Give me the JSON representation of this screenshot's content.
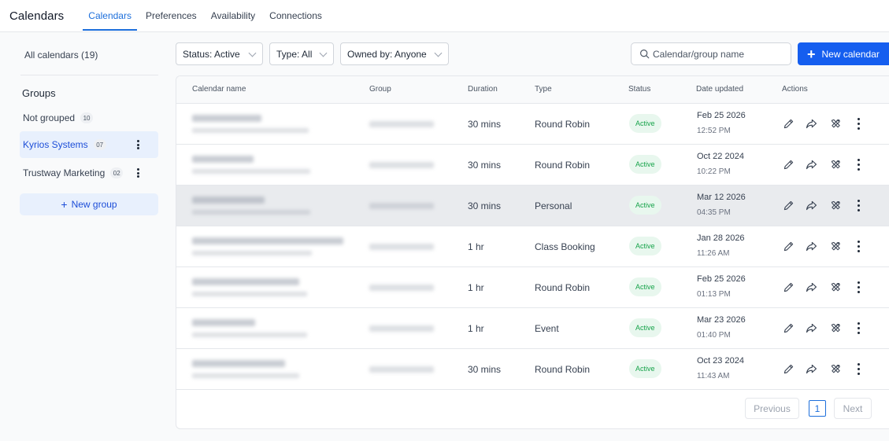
{
  "header": {
    "title": "Calendars",
    "tabs": [
      {
        "label": "Calendars",
        "active": true
      },
      {
        "label": "Preferences",
        "active": false
      },
      {
        "label": "Availability",
        "active": false
      },
      {
        "label": "Connections",
        "active": false
      }
    ]
  },
  "sidebar": {
    "all_calendars": "All calendars (19)",
    "groups_title": "Groups",
    "groups": [
      {
        "label": "Not grouped",
        "count": "10",
        "selected": false
      },
      {
        "label": "Kyrios Systems",
        "count": "07",
        "selected": true
      },
      {
        "label": "Trustway Marketing",
        "count": "02",
        "selected": false
      }
    ],
    "new_group_label": "New group"
  },
  "filters": {
    "status": "Status: Active",
    "type": "Type: All",
    "owned_by": "Owned by: Anyone"
  },
  "search": {
    "placeholder": "Calendar/group name"
  },
  "new_calendar_label": "New calendar",
  "table": {
    "columns": [
      "Calendar name",
      "Group",
      "Duration",
      "Type",
      "Status",
      "Date updated",
      "Actions"
    ],
    "rows": [
      {
        "duration": "30 mins",
        "type": "Round Robin",
        "status": "Active",
        "date": "Feb 25 2026",
        "time": "12:52 PM"
      },
      {
        "duration": "30 mins",
        "type": "Round Robin",
        "status": "Active",
        "date": "Oct 22 2024",
        "time": "10:22 PM"
      },
      {
        "duration": "30 mins",
        "type": "Personal",
        "status": "Active",
        "date": "Mar 12 2026",
        "time": "04:35 PM"
      },
      {
        "duration": "1 hr",
        "type": "Class Booking",
        "status": "Active",
        "date": "Jan 28 2026",
        "time": "11:26 AM"
      },
      {
        "duration": "1 hr",
        "type": "Round Robin",
        "status": "Active",
        "date": "Feb 25 2026",
        "time": "01:13 PM"
      },
      {
        "duration": "1 hr",
        "type": "Event",
        "status": "Active",
        "date": "Mar 23 2026",
        "time": "01:40 PM"
      },
      {
        "duration": "30 mins",
        "type": "Round Robin",
        "status": "Active",
        "date": "Oct 23 2024",
        "time": "11:43 AM"
      }
    ]
  },
  "pagination": {
    "previous": "Previous",
    "page": "1",
    "next": "Next"
  },
  "colors": {
    "accent": "#155eef",
    "active_badge_bg": "#e8f7ee",
    "active_badge_text": "#16a34a"
  },
  "icons": [
    "search-icon",
    "plus-icon",
    "chevron-down-icon",
    "pencil-icon",
    "share-icon",
    "tools-icon",
    "kebab-icon"
  ]
}
